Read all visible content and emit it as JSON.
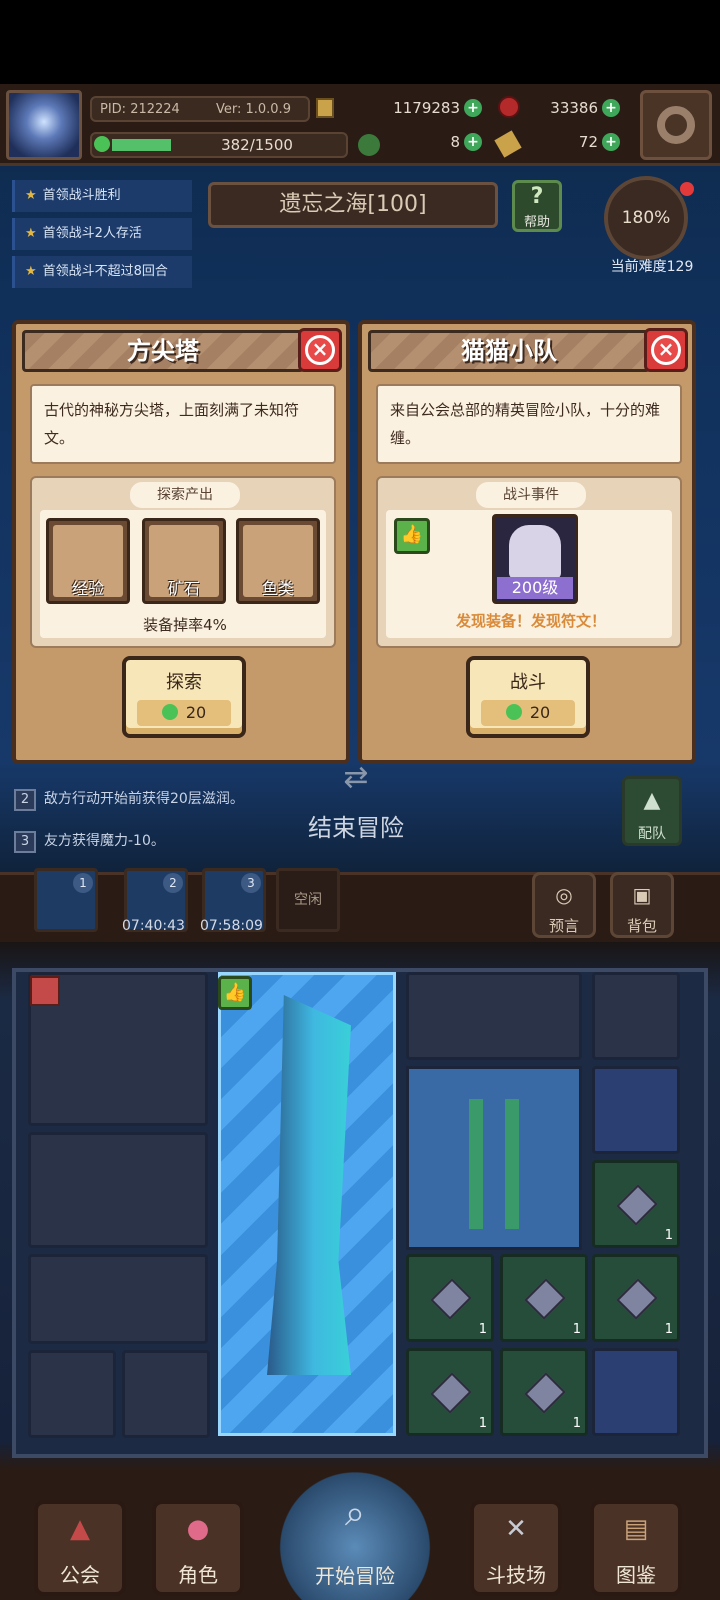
{
  "status": {
    "pid": "PID: 212224",
    "ver": "Ver: 1.0.0.9",
    "gold": "1179283",
    "gems": "33386",
    "xp": "382/1500",
    "xp_progress": 0.2547,
    "clover": "8",
    "keys": "72"
  },
  "tasks": [
    "首领战斗胜利",
    "首领战斗2人存活",
    "首领战斗不超过8回合"
  ],
  "region": {
    "title": "遗忘之海[100]",
    "help": "帮助"
  },
  "difficulty": {
    "percent": "180%",
    "label": "当前难度129"
  },
  "left_panel": {
    "title": "方尖塔",
    "description": "古代的神秘方尖塔，上面刻满了未知符文。",
    "section_title": "探索产出",
    "items": [
      "经验",
      "矿石",
      "鱼类"
    ],
    "drop_rate": "装备掉率4%",
    "button_label": "探索",
    "cost": "20"
  },
  "right_panel": {
    "title": "猫猫小队",
    "description": "来自公会总部的精英冒险小队，十分的难缠。",
    "section_title": "战斗事件",
    "level": "200级",
    "event_text": "发现装备！发现符文！",
    "button_label": "战斗",
    "cost": "20"
  },
  "rules": [
    {
      "num": "2",
      "text": "敌方行动开始前获得20层滋润。"
    },
    {
      "num": "3",
      "text": "友方获得魔力-10。"
    }
  ],
  "end_adventure": "结束冒险",
  "team": "配队",
  "dock": {
    "slot_nums": [
      "1",
      "2",
      "3"
    ],
    "timers": [
      "07:40:43",
      "07:58:09"
    ],
    "idle": "空闲",
    "prophecy": "预言",
    "bag": "背包"
  },
  "board_counts": [
    "1",
    "1",
    "1",
    "1",
    "1",
    "1"
  ],
  "nav": [
    "公会",
    "角色",
    "开始冒险",
    "斗技场",
    "图鉴"
  ],
  "colors": {
    "accent_green": "#4ac256",
    "panel": "#c49a6a",
    "close_red": "#d93b3b"
  }
}
